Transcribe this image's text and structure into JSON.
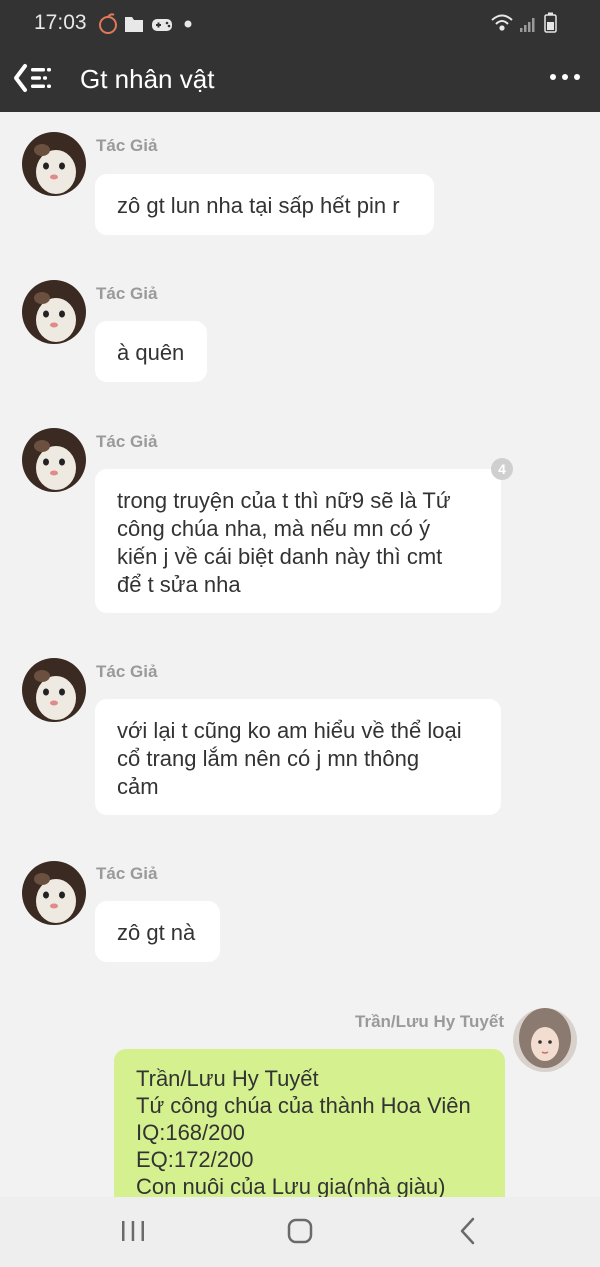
{
  "status": {
    "time": "17:03",
    "icons": [
      "peach-icon",
      "folder-icon",
      "gamepad-icon",
      "dot-icon",
      "wifi-icon",
      "signal-icon",
      "battery-icon"
    ]
  },
  "header": {
    "title": "Gt nhân vật",
    "icons": [
      "back-menu-icon",
      "more-options-icon"
    ]
  },
  "messages": [
    {
      "sender": "Tác Giả",
      "text": "zô gt lun nha tại sấp hết pin r"
    },
    {
      "sender": "Tác Giả",
      "text": "à quên"
    },
    {
      "sender": "Tác Giả",
      "text": "trong truyện của t thì nữ9 sẽ là Tứ\ncông chúa nha, mà nếu mn có ý\nkiến j về cái biệt danh này thì cmt\nđể t sửa nha",
      "badge": "4"
    },
    {
      "sender": "Tác Giả",
      "text": "với lại t cũng ko am hiểu về thể loại\ncổ trang lắm nên có j mn thông\ncảm"
    },
    {
      "sender": "Tác Giả",
      "text": "zô gt nà"
    },
    {
      "sender": "Trần/Lưu Hy Tuyết",
      "text": "Trần/Lưu Hy Tuyết\nTứ công chúa của thành Hoa Viên\nIQ:168/200\nEQ:172/200\nCon nuôi của Lưu gia(nhà giàu)"
    }
  ],
  "nav": {
    "icons": [
      "recent-apps-icon",
      "home-icon",
      "back-icon"
    ]
  },
  "colors": {
    "bar": "#333333",
    "background": "#f2f2f2",
    "bubble": "#ffffff",
    "bubble_self": "#d5f18f"
  }
}
